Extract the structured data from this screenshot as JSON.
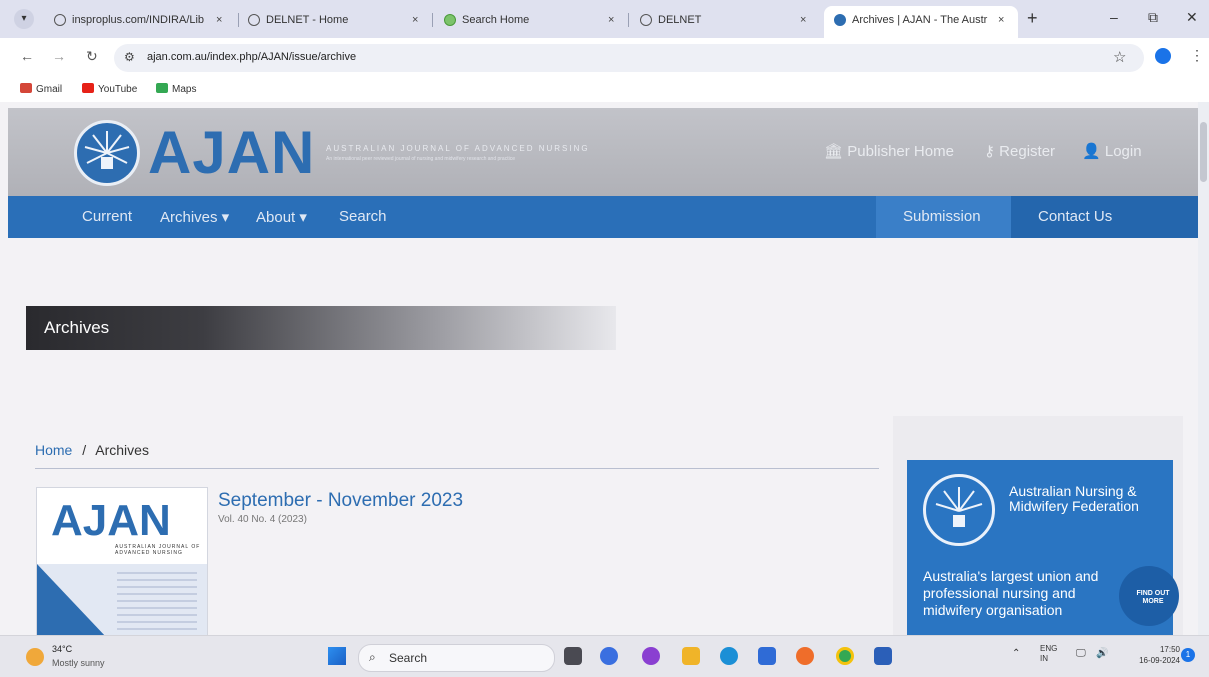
{
  "browser": {
    "tabs": [
      {
        "title": "insproplus.com/INDIRA/Lib",
        "close": "×",
        "active": false
      },
      {
        "title": "DELNET - Home",
        "close": "×",
        "active": false
      },
      {
        "title": "Search Home",
        "close": "×",
        "active": false
      },
      {
        "title": "DELNET",
        "close": "×",
        "active": false
      },
      {
        "title": "Archives | AJAN - The Austr",
        "close": "×",
        "active": true
      }
    ],
    "new_tab": "+",
    "window_controls": {
      "minimize": "–",
      "restore": "⧉",
      "close": "✕"
    },
    "url": "ajan.com.au/index.php/AJAN/issue/archive",
    "bookmarks": [
      {
        "label": "Gmail",
        "color": "#d44638"
      },
      {
        "label": "YouTube",
        "color": "#e62117"
      },
      {
        "label": "Maps",
        "color": "#34a853"
      }
    ]
  },
  "site": {
    "logo_text": "AJAN",
    "logo_subtitle": "AUSTRALIAN JOURNAL OF ADVANCED NURSING",
    "logo_tagline": "An international peer reviewed journal of nursing and midwifery research and practice",
    "header_links": {
      "publisher_home": "Publisher Home",
      "register": "Register",
      "login": "Login"
    },
    "nav": {
      "current": "Current",
      "archives": "Archives ▾",
      "about": "About ▾",
      "search": "Search",
      "submission": "Submission",
      "contact": "Contact Us"
    },
    "page_title": "Archives",
    "breadcrumb": {
      "home": "Home",
      "separator": "/",
      "current": "Archives"
    },
    "issue": {
      "cover_logo": "AJAN",
      "cover_sub": "AUSTRALIAN JOURNAL OF ADVANCED NURSING",
      "title": "September - November 2023",
      "meta": "Vol. 40 No. 4 (2023)"
    },
    "ad": {
      "org": "Australian Nursing & Midwifery Federation",
      "tagline": "Australia's largest union and professional nursing and midwifery organisation",
      "cta": "FIND OUT MORE"
    }
  },
  "taskbar": {
    "temperature": "34°C",
    "weather": "Mostly sunny",
    "search_placeholder": "Search",
    "lang": "ENG",
    "lang_sub": "IN",
    "time": "17:50",
    "date": "16-09-2024",
    "notification_count": "1"
  },
  "colors": {
    "brand_blue": "#2d6db1",
    "nav_blue": "#2a6fb8",
    "ad_blue": "#2a75c2"
  }
}
